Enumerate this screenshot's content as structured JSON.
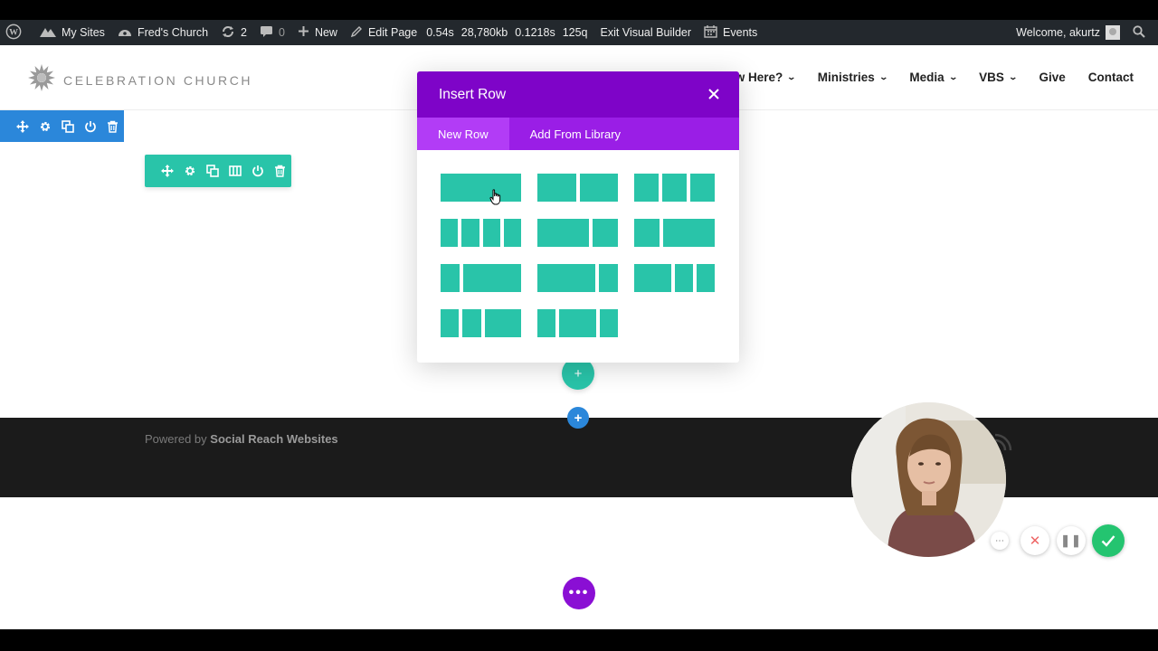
{
  "admin_bar": {
    "my_sites": "My Sites",
    "site_name": "Fred's Church",
    "updates_count": "2",
    "comments_count": "0",
    "new_label": "New",
    "edit_page": "Edit Page",
    "perf_time": "0.54s",
    "perf_memory": "28,780kb",
    "perf_query_time": "0.1218s",
    "perf_queries": "125q",
    "exit_visual_builder": "Exit Visual Builder",
    "events": "Events",
    "welcome": "Welcome, akurtz"
  },
  "site_header": {
    "logo_text": "CELEBRATION CHURCH",
    "nav": [
      {
        "label": "w Here?"
      },
      {
        "label": "Ministries"
      },
      {
        "label": "Media"
      },
      {
        "label": "VBS"
      },
      {
        "label": "Give"
      },
      {
        "label": "Contact"
      }
    ]
  },
  "modal": {
    "title": "Insert Row",
    "tabs": [
      {
        "label": "New Row",
        "active": true
      },
      {
        "label": "Add From Library",
        "active": false
      }
    ],
    "layouts": [
      {
        "name": "1 column",
        "cols": [
          1
        ]
      },
      {
        "name": "2 columns",
        "cols": [
          1,
          1
        ]
      },
      {
        "name": "3 columns",
        "cols": [
          1,
          1,
          1
        ]
      },
      {
        "name": "4 columns",
        "cols": [
          1,
          1,
          1,
          1
        ]
      },
      {
        "name": "2/3 + 1/3",
        "cols": [
          2,
          1
        ]
      },
      {
        "name": "1/3 + 2/3",
        "cols": [
          1,
          2
        ]
      },
      {
        "name": "1/4 + 3/4",
        "cols": [
          1,
          3
        ]
      },
      {
        "name": "3/4 + 1/4",
        "cols": [
          3,
          1
        ]
      },
      {
        "name": "1/2 + 1/4 + 1/4",
        "cols": [
          2,
          1,
          1
        ]
      },
      {
        "name": "1/4 + 1/4 + 1/2",
        "cols": [
          1,
          1,
          2
        ]
      },
      {
        "name": "1/4 + 1/2 + 1/4",
        "cols": [
          1,
          2,
          1
        ]
      }
    ]
  },
  "footer": {
    "powered_by": "Powered by",
    "company": "Social Reach Websites"
  },
  "colors": {
    "admin_bar": "#23282d",
    "modal_header": "#7e04c8",
    "modal_tabs": "#9a1ee6",
    "row_accent": "#29c4a9",
    "section_accent": "#2b87da",
    "footer": "#1b1b1b"
  },
  "icons": {
    "wordpress": "wordpress-icon",
    "my_sites": "sites-icon",
    "site": "dashboard-icon",
    "updates": "updates-icon",
    "comments": "comment-icon",
    "new": "plus-icon",
    "edit": "pencil-icon",
    "events": "calendar-icon",
    "search": "search-icon",
    "move": "move-icon",
    "settings": "gear-icon",
    "duplicate": "duplicate-icon",
    "columns": "columns-icon",
    "save": "power-icon",
    "delete": "trash-icon",
    "close": "close-icon",
    "rss": "rss-icon"
  }
}
